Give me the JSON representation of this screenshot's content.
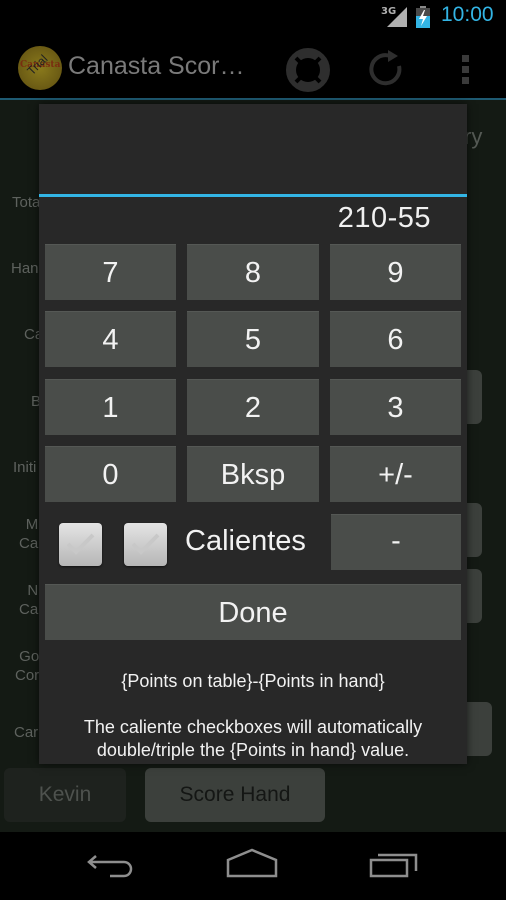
{
  "status_bar": {
    "network": "3G",
    "time": "10:00",
    "icons": [
      "signal-icon",
      "battery-charging-icon"
    ]
  },
  "action_bar": {
    "logo_text": "Canasta",
    "logo_badge": "Trial",
    "title": "Canasta Scor…",
    "actions": [
      {
        "name": "help-icon",
        "label": "Help"
      },
      {
        "name": "refresh-icon",
        "label": "Refresh"
      },
      {
        "name": "overflow-menu-icon",
        "label": "More options"
      }
    ]
  },
  "background": {
    "summary_fragment": "ry",
    "labels": [
      "Tota",
      "Han",
      "Ca",
      "B",
      "Initi",
      "M\nCa",
      "N\nCa",
      "Go\nCor",
      "Car"
    ],
    "kevin_button": "Kevin",
    "score_hand_button": "Score Hand"
  },
  "dialog": {
    "display_value": "210-55",
    "keys": [
      [
        "7",
        "8",
        "9"
      ],
      [
        "4",
        "5",
        "6"
      ],
      [
        "1",
        "2",
        "3"
      ],
      [
        "0",
        "Bksp",
        "+/-"
      ]
    ],
    "caliente_checkboxes": [
      {
        "name": "caliente-checkbox-1",
        "checked": true
      },
      {
        "name": "caliente-checkbox-2",
        "checked": true
      }
    ],
    "calientes_label": "Calientes",
    "minus_key": "-",
    "done_button": "Done",
    "help_formula": "{Points on table}-{Points in hand}",
    "help_note_line1": "The caliente checkboxes will automatically",
    "help_note_line2": "double/triple the {Points in hand} value."
  },
  "nav_bar": {
    "buttons": [
      "back-icon",
      "home-icon",
      "recents-icon"
    ]
  },
  "colors": {
    "accent": "#33b5e5",
    "dialog_bg": "#282828",
    "key_bg": "#4a4d4a",
    "screen_bg": "#141a14"
  }
}
